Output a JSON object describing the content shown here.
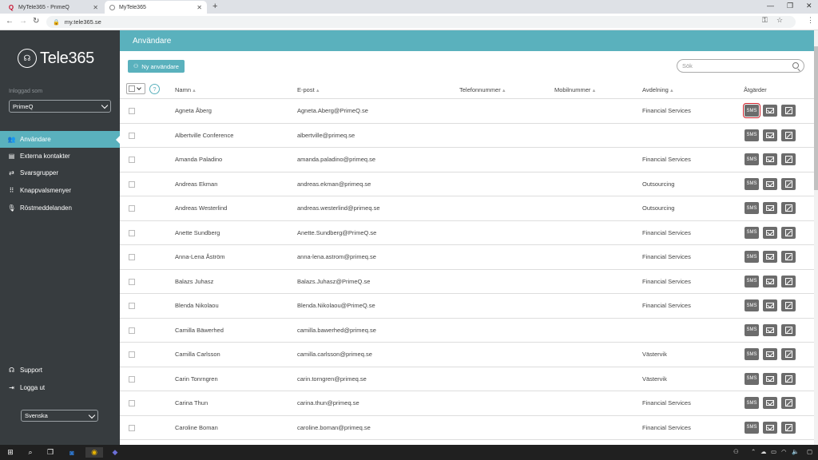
{
  "browser": {
    "tabs": [
      {
        "title": "MyTele365 - PrimeQ"
      },
      {
        "title": "MyTele365"
      }
    ],
    "url": "my.tele365.se"
  },
  "sidebar": {
    "logo_text": "Tele365",
    "logged_in_label": "Inloggad som",
    "company": "PrimeQ",
    "items": [
      {
        "label": "Användare",
        "active": true
      },
      {
        "label": "Externa kontakter"
      },
      {
        "label": "Svarsgrupper"
      },
      {
        "label": "Knappvalsmenyer"
      },
      {
        "label": "Röstmeddelanden"
      }
    ],
    "bottom_items": [
      {
        "label": "Support"
      },
      {
        "label": "Logga ut"
      }
    ],
    "language": "Svenska"
  },
  "page": {
    "title": "Användare",
    "new_user_label": "Ny användare",
    "search_placeholder": "Sök",
    "help": "?"
  },
  "table": {
    "columns": [
      "Namn",
      "E-post",
      "Telefonnummer",
      "Mobilnummer",
      "Avdelning",
      "Åtgärder"
    ],
    "action_labels": {
      "sms": "SMS"
    },
    "rows": [
      {
        "name": "Agneta Åberg",
        "email": "Agneta.Aberg@PrimeQ.se",
        "dept": "Financial Services"
      },
      {
        "name": "Albertville Conference",
        "email": "albertville@primeq.se",
        "dept": ""
      },
      {
        "name": "Amanda Paladino",
        "email": "amanda.paladino@primeq.se",
        "dept": "Financial Services"
      },
      {
        "name": "Andreas Ekman",
        "email": "andreas.ekman@primeq.se",
        "dept": "Outsourcing"
      },
      {
        "name": "Andreas Westerlind",
        "email": "andreas.westerlind@primeq.se",
        "dept": "Outsourcing"
      },
      {
        "name": "Anette Sundberg",
        "email": "Anette.Sundberg@PrimeQ.se",
        "dept": "Financial Services"
      },
      {
        "name": "Anna-Lena Åström",
        "email": "anna-lena.astrom@primeq.se",
        "dept": "Financial Services"
      },
      {
        "name": "Balazs Juhasz",
        "email": "Balazs.Juhasz@PrimeQ.se",
        "dept": "Financial Services"
      },
      {
        "name": "Blenda Nikolaou",
        "email": "Blenda.Nikolaou@PrimeQ.se",
        "dept": "Financial Services"
      },
      {
        "name": "Camilla Bäwerhed",
        "email": "camilla.bawerhed@primeq.se",
        "dept": ""
      },
      {
        "name": "Camilla Carlsson",
        "email": "camilla.carlsson@primeq.se",
        "dept": "Västervik"
      },
      {
        "name": "Carin Tonrngren",
        "email": "carin.torngren@primeq.se",
        "dept": "Västervik"
      },
      {
        "name": "Carina Thun",
        "email": "carina.thun@primeq.se",
        "dept": "Financial Services"
      },
      {
        "name": "Caroline Boman",
        "email": "caroline.boman@primeq.se",
        "dept": "Financial Services"
      }
    ]
  },
  "colors": {
    "accent": "#5ab1bd",
    "sidebar_bg": "#373c3f",
    "action_btn": "#6c6c6c",
    "highlight": "#d0202a"
  }
}
